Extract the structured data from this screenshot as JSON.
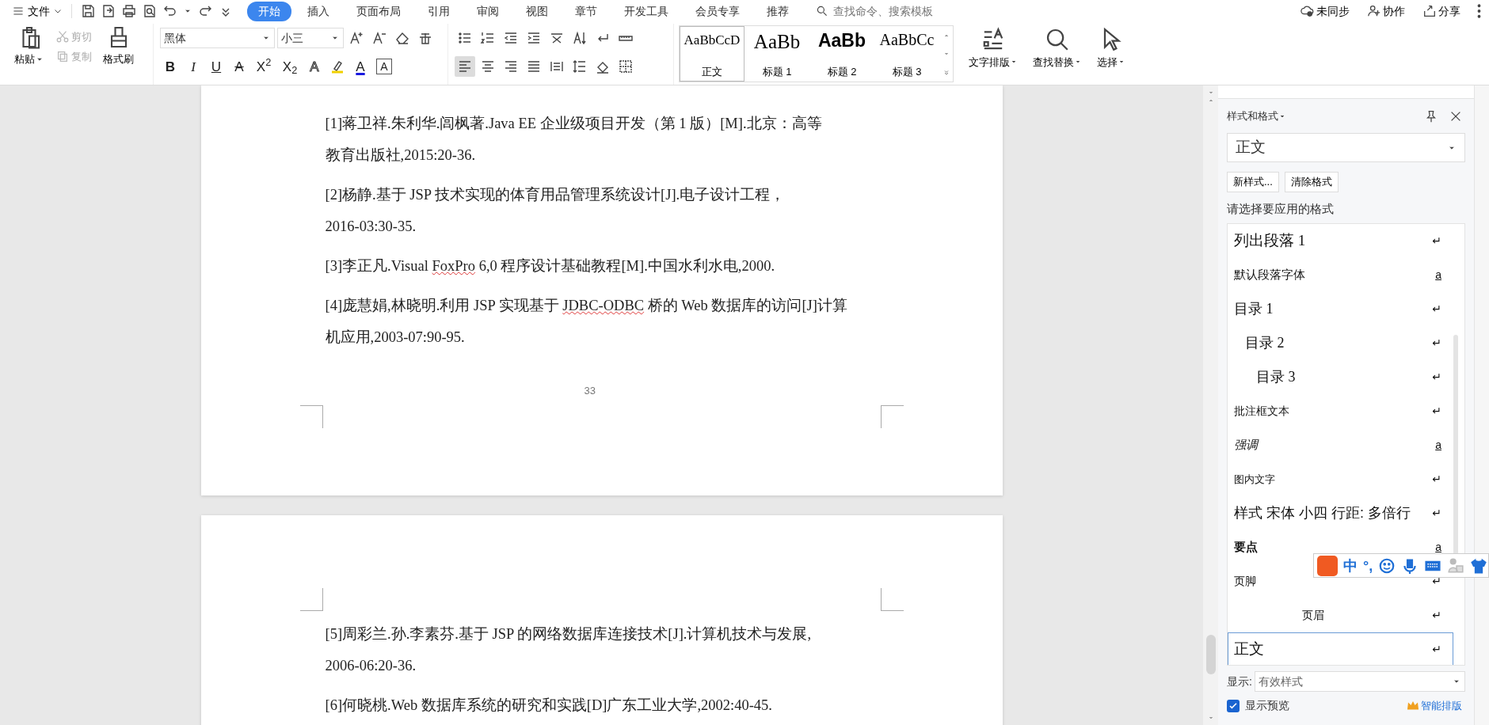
{
  "menu": {
    "label": "文件"
  },
  "tabs": [
    {
      "label": "开始",
      "selected": true
    },
    {
      "label": "插入",
      "selected": false
    },
    {
      "label": "页面布局",
      "selected": false
    },
    {
      "label": "引用",
      "selected": false
    },
    {
      "label": "审阅",
      "selected": false
    },
    {
      "label": "视图",
      "selected": false
    },
    {
      "label": "章节",
      "selected": false
    },
    {
      "label": "开发工具",
      "selected": false
    },
    {
      "label": "会员专享",
      "selected": false
    },
    {
      "label": "推荐",
      "selected": false
    }
  ],
  "search": {
    "placeholder": "查找命令、搜索模板"
  },
  "top_actions": [
    {
      "kind": "sync",
      "label": "未同步"
    },
    {
      "kind": "collab",
      "label": "协作"
    },
    {
      "kind": "share",
      "label": "分享"
    }
  ],
  "clipboard": {
    "paste": "粘贴",
    "cut": {
      "label": "剪切",
      "disabled": true
    },
    "copy": {
      "label": "复制",
      "disabled": true
    },
    "painter": "格式刷"
  },
  "font": {
    "name": "黑体",
    "size": "小三"
  },
  "font_buttons": [
    {
      "kind": "bold",
      "glyph": "B"
    },
    {
      "kind": "italic",
      "glyph": "I"
    },
    {
      "kind": "underline",
      "glyph": "U"
    },
    {
      "kind": "strike",
      "glyph": "A"
    },
    {
      "kind": "sup",
      "glyph": "X$^{2}$"
    },
    {
      "kind": "sub",
      "glyph": "X$_{2}$"
    },
    {
      "kind": "effect",
      "glyph": "A"
    },
    {
      "kind": "color",
      "glyph": "A"
    },
    {
      "kind": "boxed",
      "glyph": "A"
    }
  ],
  "alignment": [
    {
      "kind": "left",
      "selected": true
    },
    {
      "kind": "center",
      "selected": false
    },
    {
      "kind": "right",
      "selected": false
    },
    {
      "kind": "justify",
      "selected": false
    },
    {
      "kind": "distributed",
      "selected": false
    }
  ],
  "style_gallery": [
    {
      "preview": "AaBbCcD",
      "label": "正文",
      "kind": "normal",
      "selected": true
    },
    {
      "preview": "AaBb",
      "label": "标题 1",
      "kind": "h1",
      "selected": false
    },
    {
      "preview": "AaBb",
      "label": "标题 2",
      "kind": "h2",
      "selected": false
    },
    {
      "preview": "AaBbCc",
      "label": "标题 3",
      "kind": "h3",
      "selected": false
    }
  ],
  "big_buttons": [
    {
      "kind": "layout",
      "label": "文字排版"
    },
    {
      "kind": "find",
      "label": "查找替换"
    },
    {
      "kind": "select",
      "label": "选择"
    }
  ],
  "pages": [
    {
      "page_number": "33",
      "paragraphs": [
        {
          "lines": [
            [
              {
                "text": "[1]蒋卫祥.朱利华.闾枫著.Java EE 企业级项目开发（第 1 版）[M].北京：高等",
                "misspelled": false
              }
            ],
            [
              {
                "text": "教育出版社,2015:20-36.",
                "misspelled": false
              }
            ]
          ]
        },
        {
          "lines": [
            [
              {
                "text": "[2]杨静.基于 JSP 技术实现的体育用品管理系统设计[J].电子设计工程，",
                "misspelled": false
              }
            ],
            [
              {
                "text": "2016-03:30-35.",
                "misspelled": false
              }
            ]
          ]
        },
        {
          "lines": [
            [
              {
                "text": "[3]李正凡.Visual ",
                "misspelled": false
              },
              {
                "text": "FoxPro",
                "misspelled": true
              },
              {
                "text": " 6,0 程序设计基础教程[M].中国水利水电,2000.",
                "misspelled": false
              }
            ]
          ]
        },
        {
          "lines": [
            [
              {
                "text": "[4]庞慧娟,林晓明.利用 JSP 实现基于 ",
                "misspelled": false
              },
              {
                "text": "JDBC-ODBC",
                "misspelled": true
              },
              {
                "text": " 桥的 Web 数据库的访问[J]计算",
                "misspelled": false
              }
            ],
            [
              {
                "text": "机应用,2003-07:90-95.",
                "misspelled": false
              }
            ]
          ]
        }
      ]
    },
    {
      "paragraphs": [
        {
          "lines": [
            [
              {
                "text": "[5]周彩兰.孙.李素芬.基于 JSP 的网络数据库连接技术[J].计算机技术与发展,",
                "misspelled": false
              }
            ],
            [
              {
                "text": "2006-06:20-36.",
                "misspelled": false
              }
            ]
          ]
        },
        {
          "lines": [
            [
              {
                "text": "[6]何晓桃.Web 数据库系统的研究和实践[D]广东工业大学,2002:40-45.",
                "misspelled": false
              }
            ]
          ]
        }
      ]
    }
  ],
  "styles_panel": {
    "title": "样式和格式",
    "current": "正文",
    "buttons": [
      "新样式...",
      "清除格式"
    ],
    "prompt": "请选择要应用的格式",
    "items": [
      {
        "label": "列出段落 1",
        "kind": "serif-large",
        "marker": "↵",
        "underlined": false,
        "selected": false
      },
      {
        "label": "默认段落字体",
        "kind": "sans",
        "marker": "a",
        "underlined": true,
        "selected": false
      },
      {
        "label": "目录  1",
        "kind": "toc1",
        "marker": "↵",
        "underlined": false,
        "selected": false
      },
      {
        "label": "目录  2",
        "kind": "toc2",
        "marker": "↵",
        "underlined": false,
        "selected": false
      },
      {
        "label": "目录  3",
        "kind": "toc3",
        "marker": "↵",
        "underlined": false,
        "selected": false
      },
      {
        "label": "批注框文本",
        "kind": "small",
        "marker": "↵",
        "underlined": false,
        "selected": false
      },
      {
        "label": "强调",
        "kind": "italic",
        "marker": "a",
        "underlined": true,
        "selected": false
      },
      {
        "label": "图内文字",
        "kind": "tiny",
        "marker": "↵",
        "underlined": false,
        "selected": false
      },
      {
        "label": "样式  宋体  小四  行距:  多倍行",
        "kind": "sans-large",
        "marker": "↵",
        "underlined": false,
        "selected": false
      },
      {
        "label": "要点",
        "kind": "bold",
        "marker": "a",
        "underlined": true,
        "selected": false
      },
      {
        "label": "页脚",
        "kind": "small",
        "marker": "↵",
        "underlined": false,
        "selected": false
      },
      {
        "label": "页眉",
        "kind": "center",
        "marker": "↵",
        "underlined": false,
        "selected": false
      },
      {
        "label": "正文",
        "kind": "serif-large",
        "marker": "↵",
        "underlined": false,
        "selected": true
      }
    ],
    "show_label": "显示:",
    "show_value": "有效样式",
    "preview": {
      "label": "显示预览",
      "checked": true
    },
    "smart": "智能排版"
  },
  "ime": {
    "mode": "中",
    "punct": "°,"
  }
}
